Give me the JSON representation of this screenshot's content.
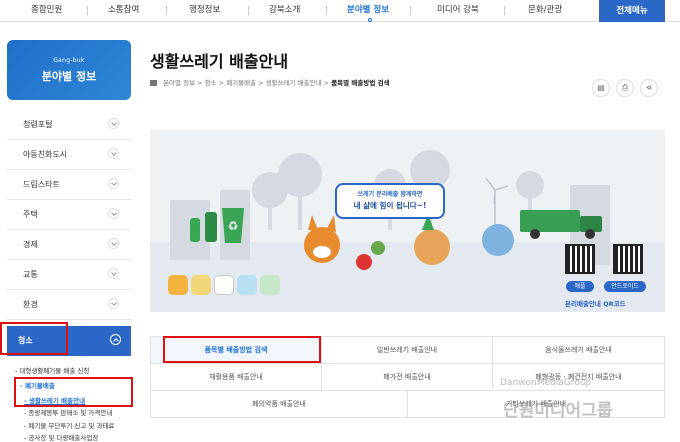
{
  "topnav": {
    "items": [
      "종합민원",
      "소통참여",
      "행정정보",
      "강북소개",
      "분야별 정보",
      "미디어 강북",
      "문화/관광"
    ],
    "active_index": 4,
    "all_menu": "전체메뉴"
  },
  "side": {
    "head_en": "Gang-buk",
    "head_ko": "분야별 정보",
    "items": [
      "청렴포털",
      "아동친화도시",
      "드림스타트",
      "주택",
      "경제",
      "교통",
      "환경"
    ],
    "active": "청소",
    "sub": [
      "- 대형생활폐기물 배출 신청",
      "- 폐기물배출",
      "- 생활쓰레기 배출안내",
      "- 종량제봉투 판매소 및 가격안내",
      "- 폐기물 무단투기 신고 및 과태료",
      "- 공사장 및 다량배출사업장"
    ]
  },
  "page": {
    "title": "생활쓰레기 배출안내",
    "breadcrumb": [
      "분야별 정보",
      "청소",
      "폐기물배출",
      "생활쓰레기 배출안내"
    ],
    "breadcrumb_current": "품목별 배출방법 검색"
  },
  "banner": {
    "sign_line1": "쓰레기 분리배출 함께하면",
    "sign_line2": "내 삶에 힘이 됩니다~!",
    "qr_ios": "애플",
    "qr_android": "안드로이드",
    "qr_label": "분리배출안내 QR코드"
  },
  "tabs": [
    "품목별 배출방법 검색",
    "일반쓰레기 배출안내",
    "음식물쓰레기 배출안내",
    "재활용품 배출안내",
    "폐가전 배출안내",
    "폐형광등 · 폐건전지 배출안내",
    "폐의약품 배출안내",
    "기타쓰레기 배출안내"
  ],
  "watermark": {
    "line1": "DanwonMediaGroup",
    "line2": "단원미디어그룹"
  },
  "colors": {
    "brand_blue": "#2b67c6",
    "highlight_red": "#dd1111"
  }
}
